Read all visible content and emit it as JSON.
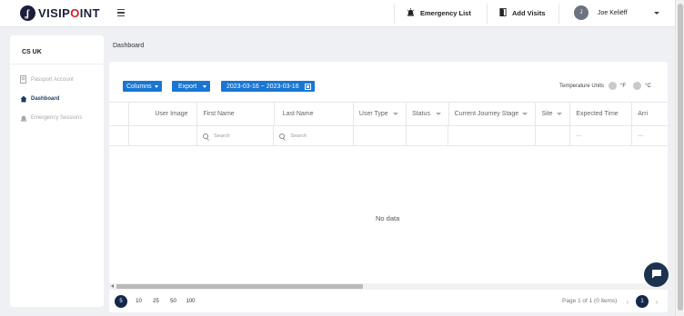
{
  "brand": {
    "mark": "ʆ",
    "name_prefix": "VISIP",
    "name_o": "O",
    "name_suffix": "INT"
  },
  "header": {
    "emergency_list": "Emergency List",
    "add_visits": "Add Visits",
    "user_initial": "J",
    "user_name": "Joe Keliëff"
  },
  "sidebar": {
    "company": "CS UK",
    "items": [
      {
        "label": "Passport Account",
        "icon": "passport-icon",
        "active": false
      },
      {
        "label": "Dashboard",
        "icon": "home-icon",
        "active": true
      },
      {
        "label": "Emergency Sessions",
        "icon": "alarm-icon",
        "active": false
      }
    ]
  },
  "breadcrumb": "Dashboard",
  "toolbar": {
    "columns_label": "Columns",
    "export_label": "Export",
    "date_range": "2023-03-16 ~ 2023-03-16",
    "temperature_label": "Temperature Units",
    "fahrenheit": "°F",
    "celsius": "°C"
  },
  "table": {
    "columns": [
      "",
      "User Image",
      "First Name",
      "Last Name",
      "User Type",
      "Status",
      "Current Journey Stage",
      "Site",
      "Expected Time",
      "Arri"
    ],
    "search_placeholder": "Search",
    "dash": "---",
    "empty_text": "No data"
  },
  "pagination": {
    "page_sizes": [
      "5",
      "10",
      "25",
      "50",
      "100"
    ],
    "selected_size": "5",
    "info": "Page 1 of 1 (0 items)",
    "current_page": "1",
    "prev": "‹",
    "next": "›"
  },
  "colors": {
    "primary": "#1976d2",
    "navy": "#14294a",
    "brand_red": "#cf2131"
  }
}
